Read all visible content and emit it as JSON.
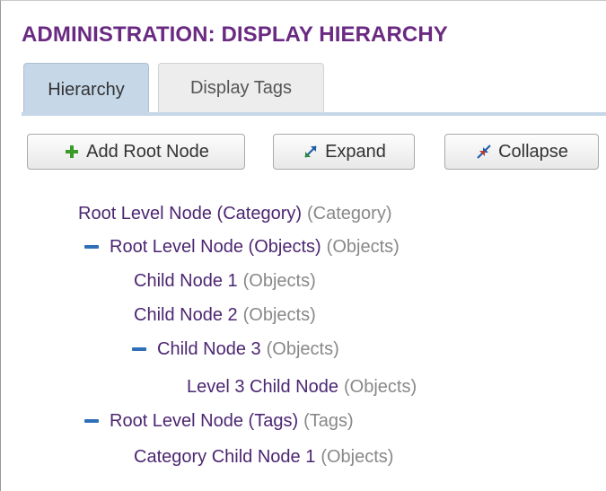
{
  "header": {
    "title": "ADMINISTRATION: DISPLAY HIERARCHY"
  },
  "tabs": [
    {
      "label": "Hierarchy",
      "active": true
    },
    {
      "label": "Display Tags",
      "active": false
    }
  ],
  "toolbar": {
    "add_root_label": "Add Root Node",
    "expand_label": "Expand",
    "collapse_label": "Collapse"
  },
  "tree": [
    {
      "name": "Root Level Node (Category)",
      "type": "(Category)",
      "collapsible": false
    },
    {
      "name": "Root Level Node (Objects)",
      "type": "(Objects)",
      "collapsible": true
    },
    {
      "name": "Child Node 1",
      "type": "(Objects)",
      "collapsible": false
    },
    {
      "name": "Child Node 2",
      "type": "(Objects)",
      "collapsible": false
    },
    {
      "name": "Child Node 3",
      "type": "(Objects)",
      "collapsible": true
    },
    {
      "name": "Level 3 Child Node",
      "type": "(Objects)",
      "collapsible": false
    },
    {
      "name": "Root Level Node (Tags)",
      "type": "(Tags)",
      "collapsible": true
    },
    {
      "name": "Category Child Node 1",
      "type": "(Objects)",
      "collapsible": false
    }
  ],
  "colors": {
    "title": "#6a2a82",
    "node_name": "#4c2672",
    "node_type": "#888888",
    "toggle": "#2e6fb8",
    "add_icon": "#3a9a2a",
    "tab_active": "#c6d7e8"
  },
  "icons": {
    "add": "plus-icon",
    "expand": "expand-arrows-icon",
    "collapse": "collapse-arrows-icon",
    "toggle": "collapse-minus-icon"
  }
}
